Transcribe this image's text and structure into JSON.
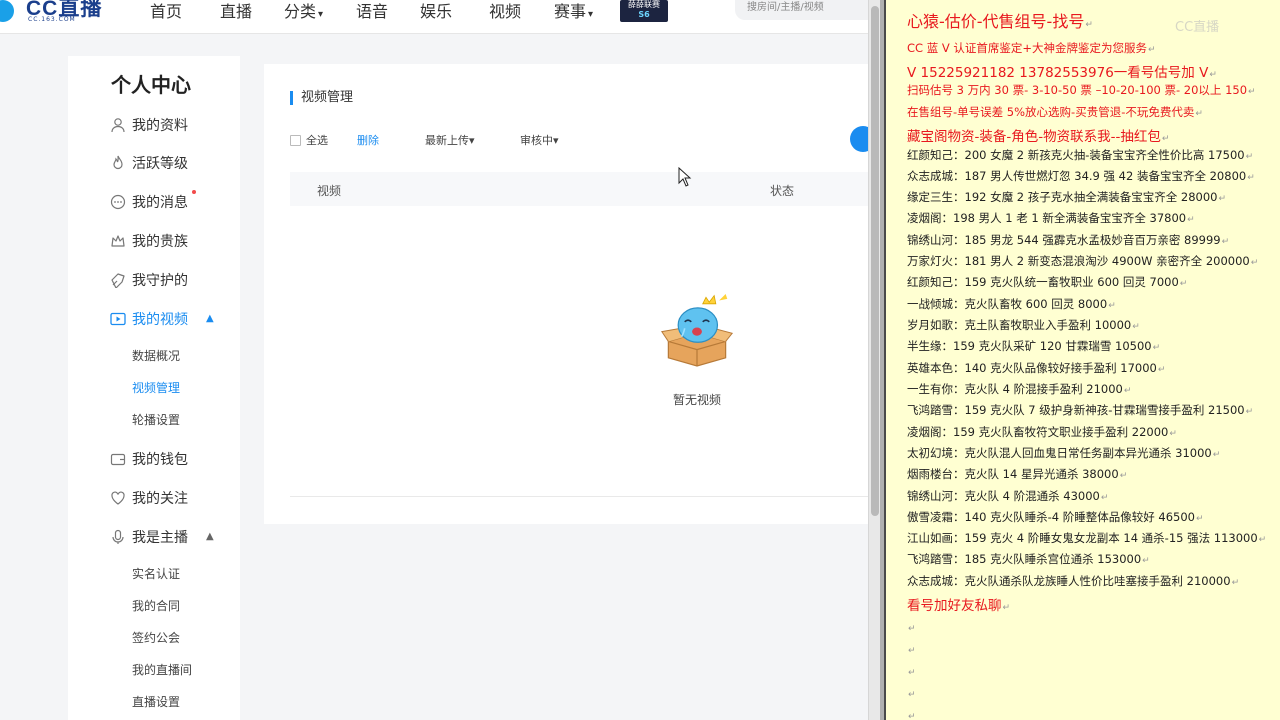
{
  "nav": {
    "logo_text": "CC直播",
    "logo_sub": "CC.163.COM",
    "items": [
      {
        "label": "首页"
      },
      {
        "label": "直播"
      },
      {
        "label": "分类"
      },
      {
        "label": "语音"
      },
      {
        "label": "娱乐"
      },
      {
        "label": "视频"
      },
      {
        "label": "赛事"
      }
    ],
    "badge_line1": "薛薛联赛",
    "badge_line2": "S6",
    "search_placeholder": "搜房间/主播/视频"
  },
  "sidebar": {
    "title": "个人中心",
    "items": [
      {
        "label": "我的资料"
      },
      {
        "label": "活跃等级"
      },
      {
        "label": "我的消息"
      },
      {
        "label": "我的贵族"
      },
      {
        "label": "我守护的"
      },
      {
        "label": "我的视频"
      },
      {
        "label": "我的钱包"
      },
      {
        "label": "我的关注"
      },
      {
        "label": "我是主播"
      }
    ],
    "video_sub": [
      {
        "label": "数据概况"
      },
      {
        "label": "视频管理"
      },
      {
        "label": "轮播设置"
      }
    ],
    "anchor_sub": [
      {
        "label": "实名认证"
      },
      {
        "label": "我的合同"
      },
      {
        "label": "签约公会"
      },
      {
        "label": "我的直播间"
      },
      {
        "label": "直播设置"
      }
    ],
    "accent_color": "#1a8cf0"
  },
  "main": {
    "heading": "视频管理",
    "select_all": "全选",
    "delete": "删除",
    "sort": "最新上传",
    "status_filter": "审核中",
    "col_video": "视频",
    "col_status": "状态",
    "empty_text": "暂无视频"
  },
  "notepad": {
    "lines": [
      {
        "text": "心猿-估价-代售组号-找号",
        "color": "red",
        "size": "big"
      },
      {
        "text": "CC 蓝 V 认证首席鉴定+大神金牌鉴定为您服务",
        "color": "red",
        "size": "normal"
      },
      {
        "text": "V 15225921182     13782553976一看号估号加 V",
        "color": "red",
        "size": "med"
      },
      {
        "text": "扫码估号 3 万内 30 票- 3-10-50 票  –10-20-100 票- 20以上 150",
        "color": "red",
        "size": "normal"
      },
      {
        "text": "在售组号-单号误差 5%放心选购-买贵管退-不玩免费代卖",
        "color": "red",
        "size": "normal"
      },
      {
        "text": "藏宝阁物资-装备-角色-物资联系我--抽红包",
        "color": "red",
        "size": "med"
      },
      {
        "text": "红颜知己：200 女魔 2 新孩克火抽-装备宝宝齐全性价比高 17500",
        "color": "black",
        "size": "normal"
      },
      {
        "text": "众志成城：187 男人传世燃灯忽 34.9 强 42 装备宝宝齐全 20800",
        "color": "black",
        "size": "normal"
      },
      {
        "text": "缘定三生：192 女魔 2 孩子克水抽全满装备宝宝齐全 28000",
        "color": "black",
        "size": "normal"
      },
      {
        "text": "凌烟阁：198 男人 1 老 1 新全满装备宝宝齐全 37800",
        "color": "black",
        "size": "normal"
      },
      {
        "text": "锦绣山河：185 男龙 544 强霹克水孟极妙音百万亲密 89999",
        "color": "black",
        "size": "normal"
      },
      {
        "text": "万家灯火：181 男人 2 新变态混浪淘沙 4900W 亲密齐全 200000",
        "color": "black",
        "size": "normal"
      },
      {
        "text": "红颜知己：159 克火队统一畜牧职业 600 回灵 7000",
        "color": "black",
        "size": "normal"
      },
      {
        "text": "一战倾城：克火队畜牧 600 回灵 8000",
        "color": "black",
        "size": "normal"
      },
      {
        "text": "岁月如歌：克土队畜牧职业入手盈利 10000",
        "color": "black",
        "size": "normal"
      },
      {
        "text": "半生缘：159 克火队采矿 120 甘霖瑞雪 10500",
        "color": "black",
        "size": "normal"
      },
      {
        "text": "英雄本色：140 克火队品像较好接手盈利 17000",
        "color": "black",
        "size": "normal"
      },
      {
        "text": "一生有你：克火队 4 阶混接手盈利 21000",
        "color": "black",
        "size": "normal"
      },
      {
        "text": "飞鸿踏雪：159 克火队 7 级护身新神孩-甘霖瑞雪接手盈利 21500",
        "color": "black",
        "size": "normal"
      },
      {
        "text": "凌烟阁：159 克火队畜牧符文职业接手盈利 22000",
        "color": "black",
        "size": "normal"
      },
      {
        "text": "太初幻境：克火队混人回血鬼日常任务副本异光通杀 31000",
        "color": "black",
        "size": "normal"
      },
      {
        "text": "烟雨楼台：克火队 14 星异光通杀 38000",
        "color": "black",
        "size": "normal"
      },
      {
        "text": "锦绣山河：克火队 4 阶混通杀 43000",
        "color": "black",
        "size": "normal"
      },
      {
        "text": "傲雪凌霜：140 克火队睡杀-4 阶睡整体品像较好 46500",
        "color": "black",
        "size": "normal"
      },
      {
        "text": "江山如画：159 克火 4 阶睡女鬼女龙副本 14 通杀-15 强法 113000",
        "color": "black",
        "size": "normal"
      },
      {
        "text": "飞鸿踏雪：185 克火队睡杀宫位通杀 153000",
        "color": "black",
        "size": "normal"
      },
      {
        "text": "众志成城：克火队通杀队龙族睡人性价比哇塞接手盈利 210000",
        "color": "black",
        "size": "normal"
      },
      {
        "text": "看号加好友私聊",
        "color": "red",
        "size": "med"
      }
    ],
    "return_mark": "↵",
    "red_color": "#e8181e",
    "background_color": "#ffffd2",
    "watermark": "CC直播"
  }
}
